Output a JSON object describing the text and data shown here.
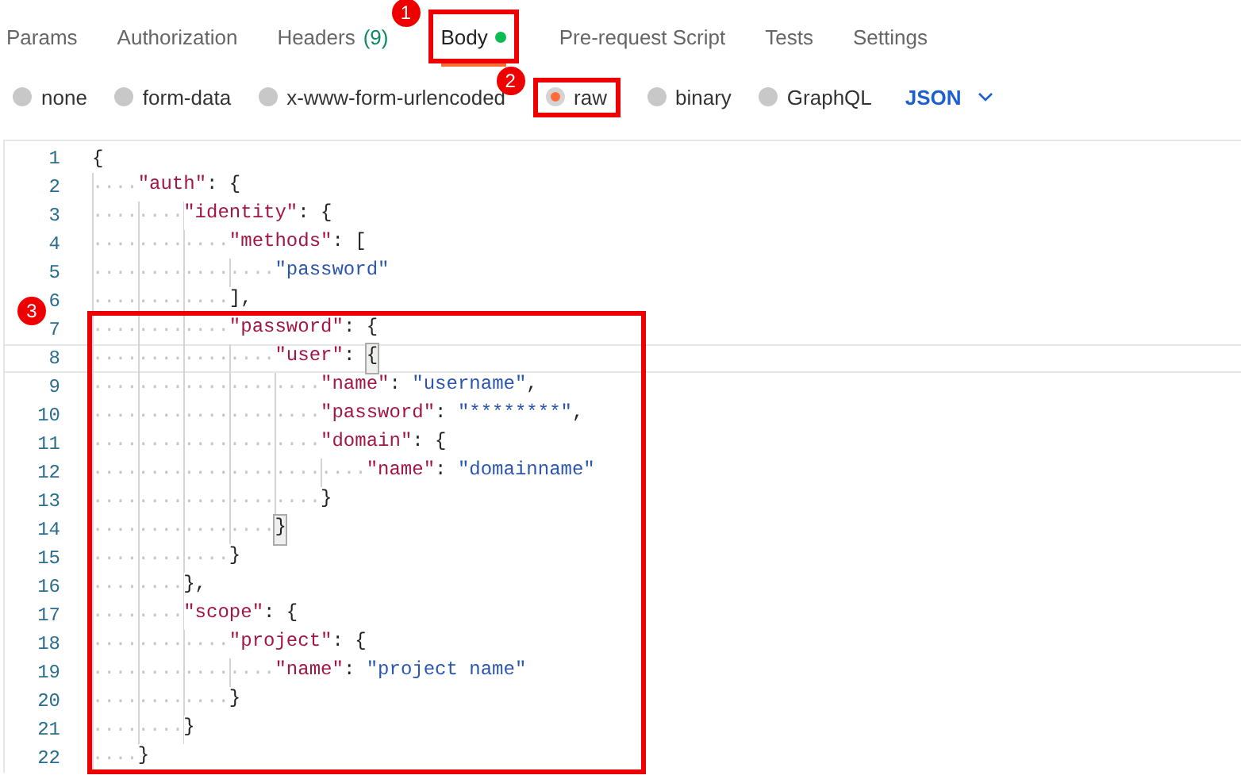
{
  "tabs": [
    {
      "label": "Params",
      "selected": false
    },
    {
      "label": "Authorization",
      "selected": false
    },
    {
      "label": "Headers",
      "count": "(9)",
      "selected": false
    },
    {
      "label": "Body",
      "dot": true,
      "selected": true,
      "callout": "1"
    },
    {
      "label": "Pre-request Script",
      "selected": false
    },
    {
      "label": "Tests",
      "selected": false
    },
    {
      "label": "Settings",
      "selected": false
    }
  ],
  "body_types": [
    {
      "label": "none",
      "selected": false
    },
    {
      "label": "form-data",
      "selected": false
    },
    {
      "label": "x-www-form-urlencoded",
      "selected": false
    },
    {
      "label": "raw",
      "selected": true,
      "callout": "2"
    },
    {
      "label": "binary",
      "selected": false
    },
    {
      "label": "GraphQL",
      "selected": false
    }
  ],
  "language": {
    "label": "JSON"
  },
  "editor": {
    "sections": [
      {
        "lines": [
          {
            "number": "1",
            "current": false,
            "tokens": [
              {
                "kind": "punct",
                "text": "{"
              }
            ]
          },
          {
            "number": "2",
            "current": false,
            "indent": "····",
            "tokens": [
              {
                "kind": "key",
                "text": "\"auth\""
              },
              {
                "kind": "punct",
                "text": ": {"
              }
            ]
          },
          {
            "number": "3",
            "current": false,
            "indent": "········",
            "tokens": [
              {
                "kind": "key",
                "text": "\"identity\""
              },
              {
                "kind": "punct",
                "text": ": {"
              }
            ]
          },
          {
            "number": "4",
            "current": false,
            "indent": "············",
            "tokens": [
              {
                "kind": "key",
                "text": "\"methods\""
              },
              {
                "kind": "punct",
                "text": ": ["
              }
            ]
          },
          {
            "number": "5",
            "current": false,
            "indent": "················",
            "tokens": [
              {
                "kind": "string",
                "text": "\"password\""
              }
            ]
          },
          {
            "number": "6",
            "current": false,
            "indent": "············",
            "tokens": [
              {
                "kind": "punct",
                "text": "],"
              }
            ]
          }
        ]
      },
      {
        "callout": "3",
        "lines": [
          {
            "number": "7",
            "current": false,
            "indent": "············",
            "tokens": [
              {
                "kind": "key",
                "text": "\"password\""
              },
              {
                "kind": "punct",
                "text": ": {"
              }
            ]
          },
          {
            "number": "8",
            "current": true,
            "indent": "················",
            "tokens": [
              {
                "kind": "key",
                "text": "\"user\""
              },
              {
                "kind": "punct",
                "text": ": "
              },
              {
                "kind": "match",
                "text": "{"
              }
            ]
          },
          {
            "number": "9",
            "current": false,
            "indent": "····················",
            "tokens": [
              {
                "kind": "key",
                "text": "\"name\""
              },
              {
                "kind": "punct",
                "text": ": "
              },
              {
                "kind": "string",
                "text": "\"username\""
              },
              {
                "kind": "punct",
                "text": ","
              }
            ]
          },
          {
            "number": "10",
            "current": false,
            "indent": "····················",
            "tokens": [
              {
                "kind": "key",
                "text": "\"password\""
              },
              {
                "kind": "punct",
                "text": ": "
              },
              {
                "kind": "string",
                "text": "\"********\""
              },
              {
                "kind": "punct",
                "text": ","
              }
            ]
          },
          {
            "number": "11",
            "current": false,
            "indent": "····················",
            "tokens": [
              {
                "kind": "key",
                "text": "\"domain\""
              },
              {
                "kind": "punct",
                "text": ": {"
              }
            ]
          },
          {
            "number": "12",
            "current": false,
            "indent": "························",
            "tokens": [
              {
                "kind": "key",
                "text": "\"name\""
              },
              {
                "kind": "punct",
                "text": ": "
              },
              {
                "kind": "string",
                "text": "\"domainname\""
              }
            ]
          },
          {
            "number": "13",
            "current": false,
            "indent": "····················",
            "tokens": [
              {
                "kind": "punct",
                "text": "}"
              }
            ]
          },
          {
            "number": "14",
            "current": false,
            "indent": "················",
            "tokens": [
              {
                "kind": "match",
                "text": "}"
              }
            ]
          },
          {
            "number": "15",
            "current": false,
            "indent": "············",
            "tokens": [
              {
                "kind": "punct",
                "text": "}"
              }
            ]
          },
          {
            "number": "16",
            "current": false,
            "indent": "········",
            "tokens": [
              {
                "kind": "punct",
                "text": "},"
              }
            ]
          },
          {
            "number": "17",
            "current": false,
            "indent": "········",
            "tokens": [
              {
                "kind": "key",
                "text": "\"scope\""
              },
              {
                "kind": "punct",
                "text": ": {"
              }
            ]
          },
          {
            "number": "18",
            "current": false,
            "indent": "············",
            "tokens": [
              {
                "kind": "key",
                "text": "\"project\""
              },
              {
                "kind": "punct",
                "text": ": {"
              }
            ]
          },
          {
            "number": "19",
            "current": false,
            "indent": "················",
            "tokens": [
              {
                "kind": "key",
                "text": "\"name\""
              },
              {
                "kind": "punct",
                "text": ": "
              },
              {
                "kind": "string",
                "text": "\"project name\""
              }
            ]
          },
          {
            "number": "20",
            "current": false,
            "indent": "············",
            "tokens": [
              {
                "kind": "punct",
                "text": "}"
              }
            ]
          },
          {
            "number": "21",
            "current": false,
            "indent": "········",
            "tokens": [
              {
                "kind": "punct",
                "text": "}"
              }
            ]
          },
          {
            "number": "22",
            "current": false,
            "indent": "····",
            "tokens": [
              {
                "kind": "punct",
                "text": "}"
              }
            ]
          }
        ]
      }
    ]
  }
}
